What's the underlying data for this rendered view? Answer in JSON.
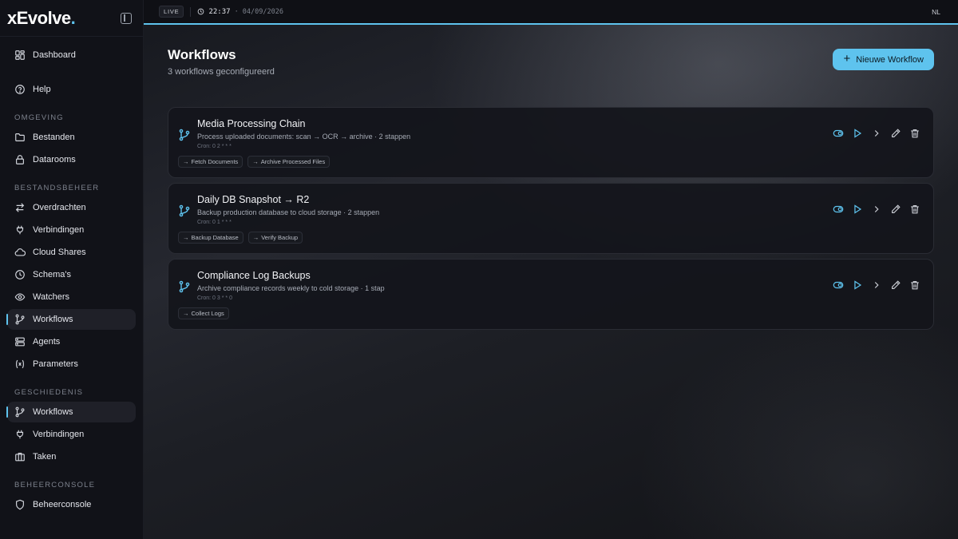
{
  "sidebar": {
    "logo": "xEvolve",
    "top_items": [
      {
        "label": "Dashboard",
        "icon": "dashboard-icon"
      },
      {
        "label": "Help",
        "icon": "help-icon"
      }
    ],
    "sections": [
      {
        "label": "OMGEVING",
        "items": [
          {
            "label": "Bestanden",
            "icon": "folder-icon"
          },
          {
            "label": "Datarooms",
            "icon": "lock-icon"
          }
        ]
      },
      {
        "label": "BESTANDSBEHEER",
        "items": [
          {
            "label": "Overdrachten",
            "icon": "transfer-icon"
          },
          {
            "label": "Verbindingen",
            "icon": "plug-icon"
          },
          {
            "label": "Cloud Shares",
            "icon": "cloud-icon"
          },
          {
            "label": "Schema's",
            "icon": "clock-icon"
          },
          {
            "label": "Watchers",
            "icon": "eye-icon"
          },
          {
            "label": "Workflows",
            "icon": "workflow-icon",
            "active": true
          },
          {
            "label": "Agents",
            "icon": "server-icon"
          },
          {
            "label": "Parameters",
            "icon": "variable-icon"
          }
        ]
      },
      {
        "label": "GESCHIEDENIS",
        "items": [
          {
            "label": "Workflows",
            "icon": "workflow-icon",
            "active": true
          },
          {
            "label": "Verbindingen",
            "icon": "plug-icon"
          },
          {
            "label": "Taken",
            "icon": "briefcase-icon"
          }
        ]
      },
      {
        "label": "BEHEERCONSOLE",
        "items": [
          {
            "label": "Beheerconsole",
            "icon": "shield-icon"
          }
        ]
      }
    ]
  },
  "topbar": {
    "live": "LIVE",
    "time": "22:37",
    "date": "· 04/09/2026",
    "lang": "NL"
  },
  "page": {
    "title": "Workflows",
    "subtitle": "3 workflows geconfigureerd",
    "new_button": "Nieuwe Workflow"
  },
  "workflows": [
    {
      "name": "Media Processing Chain",
      "description": "Process uploaded documents: scan → OCR → archive · 2 stappen",
      "cron": "Cron: 0 2 * * *",
      "steps": [
        "Fetch Documents",
        "Archive Processed Files"
      ]
    },
    {
      "name": "Daily DB Snapshot → R2",
      "description": "Backup production database to cloud storage · 2 stappen",
      "cron": "Cron: 0 1 * * *",
      "steps": [
        "Backup Database",
        "Verify Backup"
      ]
    },
    {
      "name": "Compliance Log Backups",
      "description": "Archive compliance records weekly to cold storage · 1 stap",
      "cron": "Cron: 0 3 * * 0",
      "steps": [
        "Collect Logs"
      ]
    }
  ],
  "colors": {
    "accent": "#5ec3ee",
    "sidebar_bg": "#111218",
    "card_bg": "#14151b"
  }
}
